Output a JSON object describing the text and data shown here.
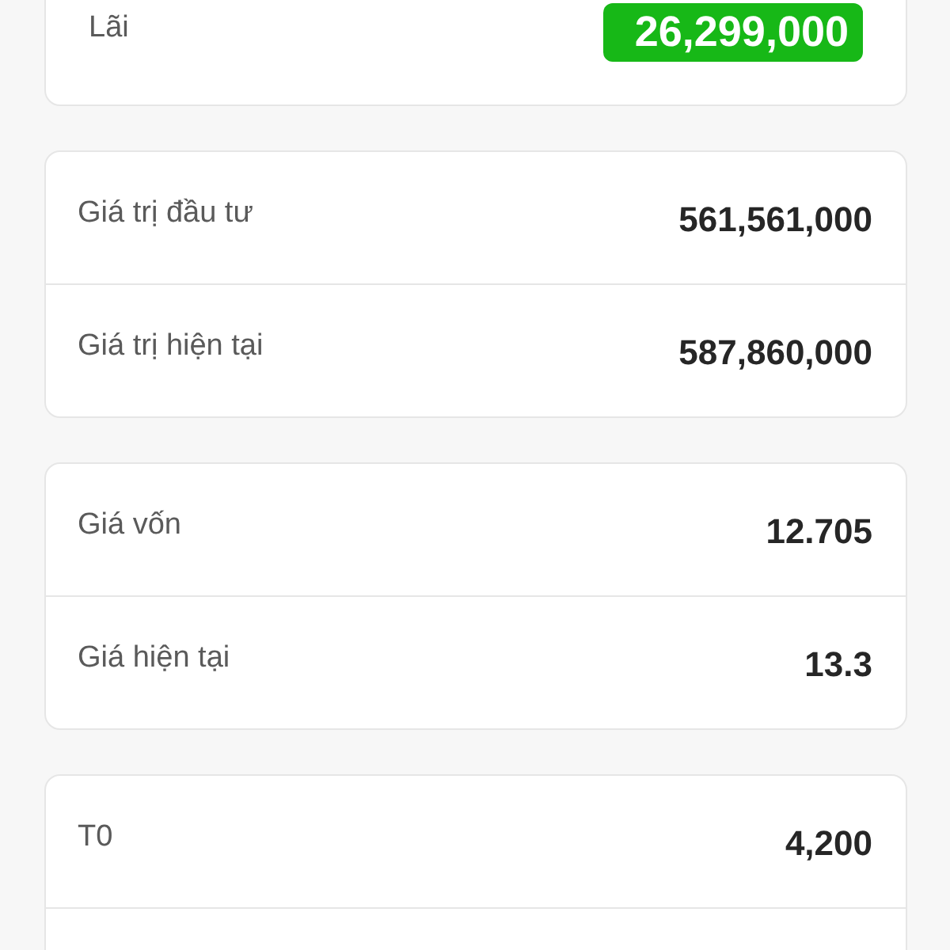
{
  "sections": [
    {
      "truncated": false,
      "rows": [
        {
          "kind": "badge",
          "label": "Lãi",
          "value": "26,299,000"
        }
      ]
    },
    {
      "truncated": false,
      "rows": [
        {
          "kind": "plain",
          "label": "Giá trị đầu tư",
          "value": "561,561,000"
        },
        {
          "kind": "plain",
          "label": "Giá trị hiện tại",
          "value": "587,860,000"
        }
      ]
    },
    {
      "truncated": false,
      "rows": [
        {
          "kind": "plain",
          "label": "Giá vốn",
          "value": "12.705"
        },
        {
          "kind": "plain",
          "label": "Giá hiện tại",
          "value": "13.3"
        }
      ]
    },
    {
      "truncated": true,
      "rows": [
        {
          "kind": "plain",
          "label": "T0",
          "value": "4,200"
        }
      ]
    }
  ]
}
